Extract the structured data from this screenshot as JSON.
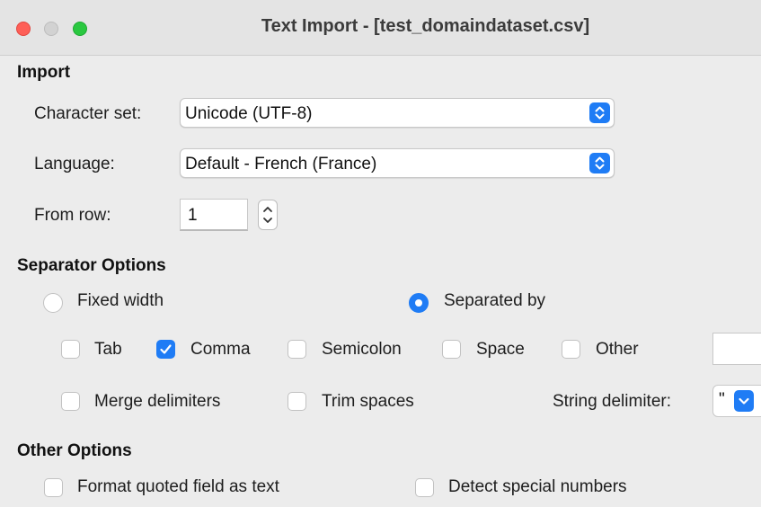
{
  "window": {
    "title": "Text Import - [test_domaindataset.csv]"
  },
  "import": {
    "heading": "Import",
    "character_set": {
      "label": "Character set:",
      "value": "Unicode (UTF-8)"
    },
    "language": {
      "label": "Language:",
      "value": "Default - French (France)"
    },
    "from_row": {
      "label": "From row:",
      "value": "1"
    }
  },
  "separator_options": {
    "heading": "Separator Options",
    "fixed_width": {
      "label": "Fixed width",
      "selected": false
    },
    "separated_by": {
      "label": "Separated by",
      "selected": true
    },
    "tab": {
      "label": "Tab",
      "checked": false
    },
    "comma": {
      "label": "Comma",
      "checked": true
    },
    "semicolon": {
      "label": "Semicolon",
      "checked": false
    },
    "space": {
      "label": "Space",
      "checked": false
    },
    "other": {
      "label": "Other",
      "checked": false,
      "value": ""
    },
    "merge_delimiters": {
      "label": "Merge delimiters",
      "checked": false
    },
    "trim_spaces": {
      "label": "Trim spaces",
      "checked": false
    },
    "string_delimiter": {
      "label": "String delimiter:",
      "value": "\""
    }
  },
  "other_options": {
    "heading": "Other Options",
    "format_quoted_field": {
      "label": "Format quoted field as text",
      "checked": false
    },
    "detect_special_numbers": {
      "label": "Detect special numbers",
      "checked": false
    }
  },
  "colors": {
    "accent": "#1f7cf5",
    "window_bg": "#ececec",
    "close": "#fe5f57",
    "minimize": "#d2d2d2",
    "zoom": "#2ac840"
  },
  "icons": {
    "updown": "select-updown-icon",
    "check": "checkmark-icon",
    "chevron": "chevron-down-icon"
  }
}
